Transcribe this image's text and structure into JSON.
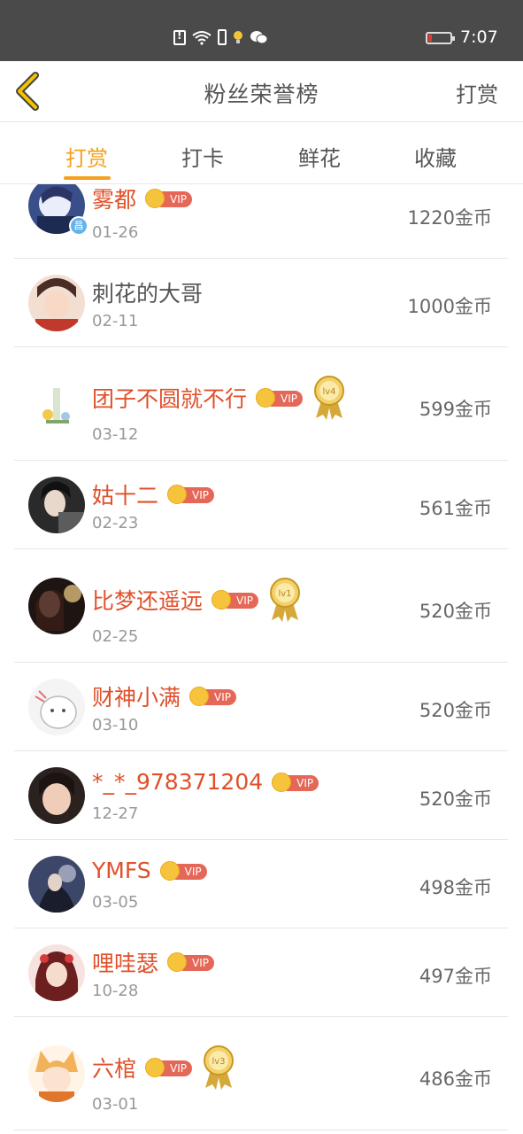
{
  "status_bar": {
    "time": "7:07"
  },
  "nav": {
    "title": "粉丝荣誉榜",
    "right_action": "打赏"
  },
  "tabs": [
    {
      "label": "打赏",
      "active": true
    },
    {
      "label": "打卡",
      "active": false
    },
    {
      "label": "鲜花",
      "active": false
    },
    {
      "label": "收藏",
      "active": false
    }
  ],
  "badges": {
    "vip": "VIP",
    "avatar_badge": "昌"
  },
  "fans": [
    {
      "name": "雾都",
      "date": "01-26",
      "amount": "1220金币",
      "vip": true,
      "level": null
    },
    {
      "name": "刺花的大哥",
      "date": "02-11",
      "amount": "1000金币",
      "vip": false,
      "level": null
    },
    {
      "name": "团子不圆就不行",
      "date": "03-12",
      "amount": "599金币",
      "vip": true,
      "level": "lv4"
    },
    {
      "name": "姑十二",
      "date": "02-23",
      "amount": "561金币",
      "vip": true,
      "level": null
    },
    {
      "name": "比梦还遥远",
      "date": "02-25",
      "amount": "520金币",
      "vip": true,
      "level": "lv1"
    },
    {
      "name": "财神小满",
      "date": "03-10",
      "amount": "520金币",
      "vip": true,
      "level": null
    },
    {
      "name": "*_*_978371204",
      "date": "12-27",
      "amount": "520金币",
      "vip": true,
      "level": null
    },
    {
      "name": "YMFS",
      "date": "03-05",
      "amount": "498金币",
      "vip": true,
      "level": null
    },
    {
      "name": "哩哇瑟",
      "date": "10-28",
      "amount": "497金币",
      "vip": true,
      "level": null
    },
    {
      "name": "六棺",
      "date": "03-01",
      "amount": "486金币",
      "vip": true,
      "level": "lv3"
    }
  ],
  "colors": {
    "accent": "#f4a11e",
    "name_red": "#e0502a",
    "vip_red": "#e56757",
    "status_bar": "#4a4a4a"
  }
}
